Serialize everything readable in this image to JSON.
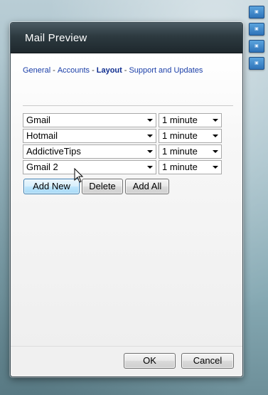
{
  "window": {
    "title": "Mail Preview"
  },
  "nav": {
    "links": [
      {
        "label": "General"
      },
      {
        "label": "Accounts"
      },
      {
        "label": "Layout"
      },
      {
        "label": "Support and Updates"
      }
    ],
    "active": "Layout",
    "separator": "-"
  },
  "accounts": [
    {
      "name": "Gmail",
      "interval": "1 minute"
    },
    {
      "name": "Hotmail",
      "interval": "1 minute"
    },
    {
      "name": "AddictiveTips",
      "interval": "1 minute"
    },
    {
      "name": "Gmail 2",
      "interval": "1 minute"
    }
  ],
  "actions": {
    "add_new": "Add New",
    "delete": "Delete",
    "add_all": "Add All"
  },
  "footer": {
    "ok": "OK",
    "cancel": "Cancel"
  },
  "colors": {
    "link": "#1a3ea8",
    "titlebar": "#2d3a40",
    "hover_button": "#bee6fd"
  },
  "icons": [
    "gadget-icon",
    "dropdown-arrow-icon",
    "mouse-cursor-icon"
  ]
}
